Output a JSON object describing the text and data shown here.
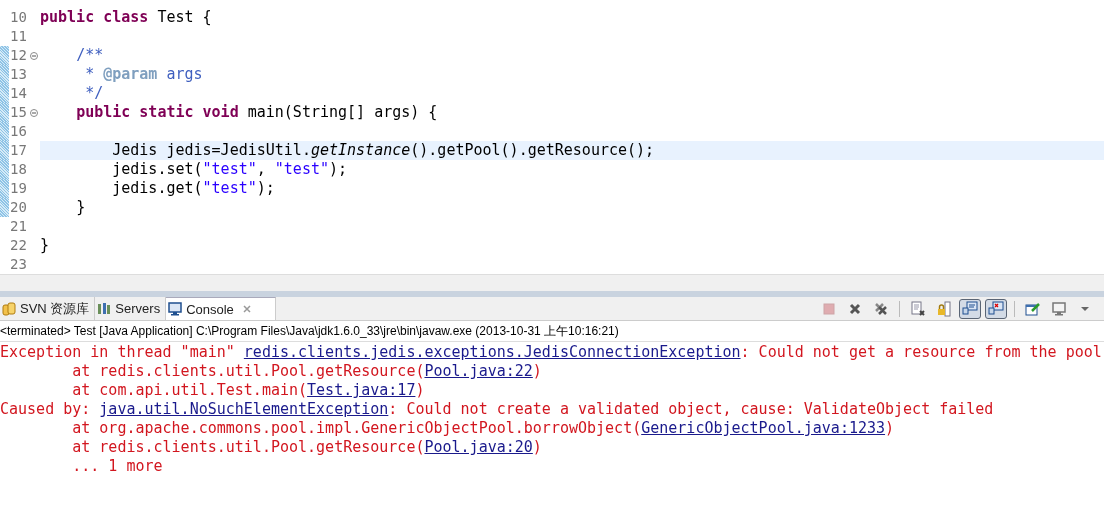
{
  "editor": {
    "lines": [
      {
        "number": "10",
        "changed": false,
        "current": false,
        "foldable": false,
        "segments": [
          {
            "kind": "keyword",
            "text": "public"
          },
          {
            "kind": "keyword",
            "text": " class"
          },
          {
            "kind": "plain",
            "text": " Test {"
          }
        ]
      },
      {
        "number": "11",
        "changed": false,
        "current": false,
        "foldable": false
      },
      {
        "number": "12",
        "changed": true,
        "current": false,
        "foldable": true,
        "segments": [
          {
            "kind": "doc",
            "text": "    /**"
          }
        ]
      },
      {
        "number": "13",
        "changed": true,
        "current": false,
        "foldable": false,
        "segments": [
          {
            "kind": "doc",
            "text": "     *"
          },
          {
            "kind": "doctag",
            "text": " @param"
          },
          {
            "kind": "doc",
            "text": " args"
          }
        ]
      },
      {
        "number": "14",
        "changed": true,
        "current": false,
        "foldable": false,
        "segments": [
          {
            "kind": "doc",
            "text": "     */"
          }
        ]
      },
      {
        "number": "15",
        "changed": true,
        "current": false,
        "foldable": true,
        "segments": [
          {
            "kind": "keyword",
            "text": "    public"
          },
          {
            "kind": "keyword",
            "text": " static"
          },
          {
            "kind": "keyword",
            "text": " void"
          },
          {
            "kind": "plain",
            "text": " main(String[] args) {"
          }
        ]
      },
      {
        "number": "16",
        "changed": true,
        "current": false,
        "foldable": false
      },
      {
        "number": "17",
        "changed": true,
        "current": true,
        "foldable": false,
        "segments": [
          {
            "kind": "plain",
            "text": "        Jedis jedis=JedisUtil."
          },
          {
            "kind": "italic",
            "text": "getInstance"
          },
          {
            "kind": "plain",
            "text": "().getPool().getResource();"
          }
        ]
      },
      {
        "number": "18",
        "changed": true,
        "current": false,
        "foldable": false,
        "segments": [
          {
            "kind": "plain",
            "text": "        jedis.set("
          },
          {
            "kind": "string",
            "text": "\"test\""
          },
          {
            "kind": "plain",
            "text": ","
          },
          {
            "kind": "string",
            "text": " \"test\""
          },
          {
            "kind": "plain",
            "text": ");"
          }
        ]
      },
      {
        "number": "19",
        "changed": true,
        "current": false,
        "foldable": false,
        "segments": [
          {
            "kind": "plain",
            "text": "        jedis.get("
          },
          {
            "kind": "string",
            "text": "\"test\""
          },
          {
            "kind": "plain",
            "text": ");"
          }
        ]
      },
      {
        "number": "20",
        "changed": true,
        "current": false,
        "foldable": false,
        "segments": [
          {
            "kind": "plain",
            "text": "    }"
          }
        ]
      },
      {
        "number": "21",
        "changed": false,
        "current": false,
        "foldable": false
      },
      {
        "number": "22",
        "changed": false,
        "current": false,
        "foldable": false,
        "segments": [
          {
            "kind": "plain",
            "text": "}"
          }
        ]
      },
      {
        "number": "23",
        "changed": false,
        "current": false,
        "foldable": false
      }
    ]
  },
  "tabs": [
    {
      "label": "SVN 资源库",
      "selected": false,
      "closable": false
    },
    {
      "label": "Servers",
      "selected": false,
      "closable": false
    },
    {
      "label": "Console",
      "selected": true,
      "closable": true
    }
  ],
  "toolbar": [
    [
      {
        "kind": "stop",
        "disabled": true
      },
      {
        "kind": "remove",
        "disabled": false
      },
      {
        "kind": "remove-all",
        "disabled": false
      }
    ],
    [
      {
        "kind": "clear",
        "pressed": false
      },
      {
        "kind": "scroll-lock",
        "pressed": false
      },
      {
        "kind": "stdout",
        "pressed": true
      },
      {
        "kind": "stderr",
        "pressed": true
      }
    ],
    [
      {
        "kind": "pin"
      },
      {
        "kind": "display"
      },
      {
        "kind": "menu"
      }
    ]
  ],
  "console": {
    "status": "<terminated> Test [Java Application] C:\\Program Files\\Java\\jdk1.6.0_33\\jre\\bin\\javaw.exe (2013-10-31 上午10:16:21)",
    "lines": [
      [
        {
          "kind": "error",
          "text": "Exception in thread \"main\" "
        },
        {
          "kind": "link",
          "text": "redis.clients.jedis.exceptions.JedisConnectionException"
        },
        {
          "kind": "error",
          "text": ": Could not get a resource from the pool"
        }
      ],
      [
        {
          "kind": "error",
          "text": "        at redis.clients.util.Pool.getResource("
        },
        {
          "kind": "link",
          "text": "Pool.java:22"
        },
        {
          "kind": "error",
          "text": ")"
        }
      ],
      [
        {
          "kind": "error",
          "text": "        at com.api.util.Test.main("
        },
        {
          "kind": "link",
          "text": "Test.java:17"
        },
        {
          "kind": "error",
          "text": ")"
        }
      ],
      [
        {
          "kind": "error",
          "text": "Caused by: "
        },
        {
          "kind": "link",
          "text": "java.util.NoSuchElementException"
        },
        {
          "kind": "error",
          "text": ": Could not create a validated object, cause: ValidateObject failed"
        }
      ],
      [
        {
          "kind": "error",
          "text": "        at org.apache.commons.pool.impl.GenericObjectPool.borrowObject("
        },
        {
          "kind": "link",
          "text": "GenericObjectPool.java:1233"
        },
        {
          "kind": "error",
          "text": ")"
        }
      ],
      [
        {
          "kind": "error",
          "text": "        at redis.clients.util.Pool.getResource("
        },
        {
          "kind": "link",
          "text": "Pool.java:20"
        },
        {
          "kind": "error",
          "text": ")"
        }
      ],
      [
        {
          "kind": "error",
          "text": "        ... 1 more"
        }
      ]
    ]
  }
}
